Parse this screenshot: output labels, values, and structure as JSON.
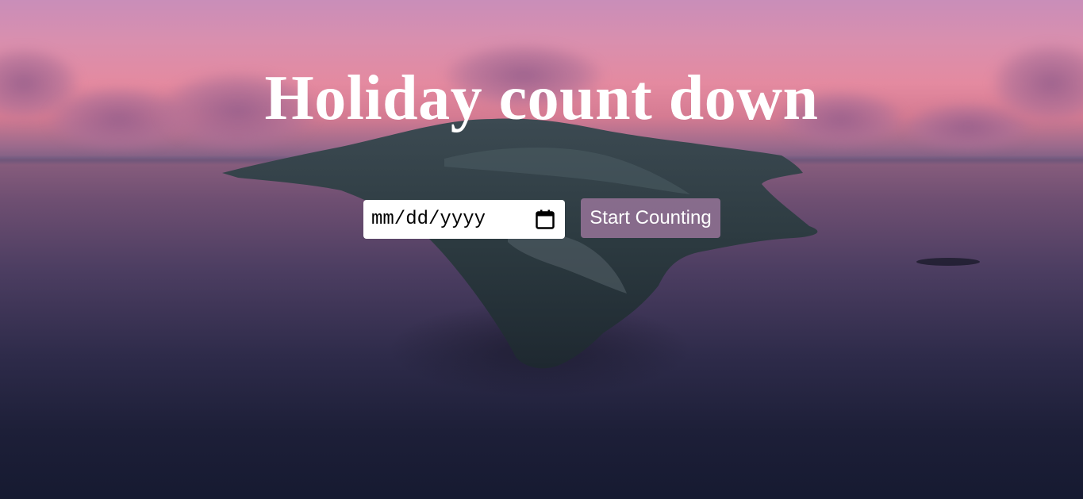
{
  "page": {
    "title": "Holiday count down"
  },
  "date_field": {
    "placeholder": "mm/dd/yyyy",
    "icon": "calendar-icon"
  },
  "start_button": {
    "label": "Start Counting"
  },
  "colors": {
    "title_text": "#ffffff",
    "button_bg": "#a078a0",
    "sky_pink": "#e48aa0",
    "sea_dark": "#161a31"
  }
}
